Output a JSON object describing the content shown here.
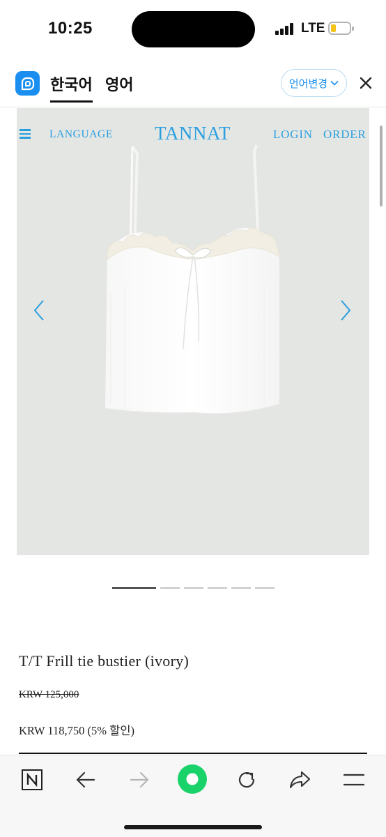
{
  "status_bar": {
    "time": "10:25",
    "network": "LTE",
    "battery_level": 0.2,
    "battery_color": "#f4c21a"
  },
  "translate_bar": {
    "logo_icon": "papago-translate-icon",
    "tab_active": "한국어",
    "tab_other": "영어",
    "change_button": "언어변경",
    "accent_color": "#1a8ff0"
  },
  "site_nav": {
    "language": "LANGUAGE",
    "brand": "TANNAT",
    "login": "LOGIN",
    "order": "ORDER",
    "link_color": "#2a9fe0"
  },
  "gallery": {
    "total_images": 6,
    "current_image": 1
  },
  "product": {
    "title": "T/T Frill tie bustier (ivory)",
    "original_price": "KRW 125,000",
    "sale_price": "KRW 118,750 (5% 할인)"
  },
  "toolbar": {
    "icons": [
      "naver-icon",
      "back-arrow-icon",
      "forward-arrow-icon",
      "green-dot-icon",
      "reload-icon",
      "share-icon",
      "menu-icon"
    ],
    "highlight_color": "#19d36a"
  }
}
